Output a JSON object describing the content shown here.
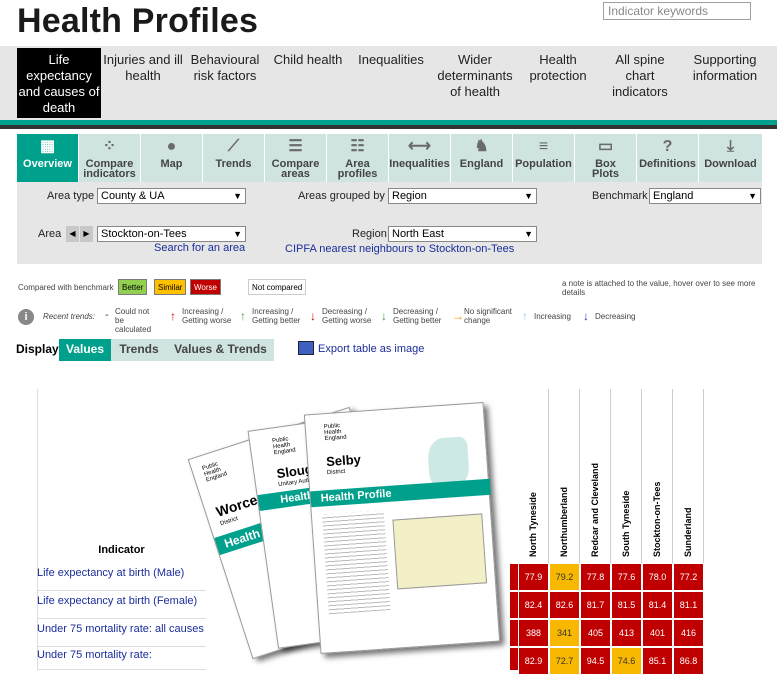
{
  "header": {
    "title": "Health Profiles",
    "search_placeholder": "Indicator keywords"
  },
  "nav": {
    "items": [
      {
        "label": "Life expectancy and causes of death"
      },
      {
        "label": "Injuries and ill health"
      },
      {
        "label": "Behavioural risk factors"
      },
      {
        "label": "Child health"
      },
      {
        "label": "Inequalities"
      },
      {
        "label": "Wider determinants of health"
      },
      {
        "label": "Health protection"
      },
      {
        "label": "All spine chart indicators"
      },
      {
        "label": "Supporting information"
      }
    ]
  },
  "tabs": [
    {
      "label": "Overview",
      "icon": "grid-icon"
    },
    {
      "label": "Compare indicators",
      "icon": "scatter-icon"
    },
    {
      "label": "Map",
      "icon": "pin-icon"
    },
    {
      "label": "Trends",
      "icon": "line-chart-icon"
    },
    {
      "label": "Compare areas",
      "icon": "bars-icon"
    },
    {
      "label": "Area profiles",
      "icon": "sliders-icon"
    },
    {
      "label": "Inequalities",
      "icon": "range-icon"
    },
    {
      "label": "England",
      "icon": "england-icon"
    },
    {
      "label": "Population",
      "icon": "population-icon"
    },
    {
      "label": "Box Plots",
      "icon": "boxplot-icon"
    },
    {
      "label": "Definitions",
      "icon": "question-icon"
    },
    {
      "label": "Download",
      "icon": "download-icon"
    }
  ],
  "filters": {
    "area_type_label": "Area type",
    "area_type_value": "County & UA",
    "grouped_label": "Areas grouped by",
    "grouped_value": "Region",
    "benchmark_label": "Benchmark",
    "benchmark_value": "England",
    "area_label": "Area",
    "area_value": "Stockton-on-Tees",
    "region_label": "Region",
    "region_value": "North East",
    "search_area_link": "Search for an area",
    "cipfa_link": "CIPFA nearest neighbours to Stockton-on-Tees"
  },
  "legend": {
    "compared_label": "Compared with benchmark",
    "better": "Better",
    "similar": "Similar",
    "worse": "Worse",
    "not_compared": "Not compared",
    "note": "a note is attached to the value, hover over to see more details",
    "recent_trends_label": "Recent trends:",
    "trends": [
      {
        "symbol": "-",
        "text": "Could not be calculated"
      },
      {
        "symbol": "↑",
        "text": "Increasing / Getting worse"
      },
      {
        "symbol": "↑",
        "text": "Increasing / Getting better"
      },
      {
        "symbol": "↓",
        "text": "Decreasing / Getting worse"
      },
      {
        "symbol": "↓",
        "text": "Decreasing / Getting better"
      },
      {
        "symbol": "→",
        "text": "No significant change"
      },
      {
        "symbol": "↑",
        "text": "Increasing"
      },
      {
        "symbol": "↓",
        "text": "Decreasing"
      }
    ],
    "colors": {
      "better": "#92d050",
      "similar": "#ffc000",
      "worse": "#c00000"
    }
  },
  "display": {
    "label": "Display",
    "options": [
      "Values",
      "Trends",
      "Values & Trends"
    ],
    "export_label": "Export table as image"
  },
  "table": {
    "indicator_header": "Indicator",
    "areas": [
      "North Tyneside",
      "Northumberland",
      "Redcar and Cleveland",
      "South Tyneside",
      "Stockton-on-Tees",
      "Sunderland"
    ],
    "rows": [
      {
        "indicator": "Life expectancy at birth (Male)",
        "values": [
          "77.9",
          "79.2",
          "77.8",
          "77.6",
          "78.0",
          "77.2"
        ],
        "status": [
          "worse",
          "similar",
          "worse",
          "worse",
          "worse",
          "worse"
        ]
      },
      {
        "indicator": "Life expectancy at birth (Female)",
        "values": [
          "82.4",
          "82.6",
          "81.7",
          "81.5",
          "81.4",
          "81.1"
        ],
        "status": [
          "worse",
          "worse",
          "worse",
          "worse",
          "worse",
          "worse"
        ]
      },
      {
        "indicator": "Under 75 mortality rate: all causes",
        "values": [
          "388",
          "341",
          "405",
          "413",
          "401",
          "416"
        ],
        "status": [
          "worse",
          "similar",
          "worse",
          "worse",
          "worse",
          "worse"
        ]
      },
      {
        "indicator": "Under 75 mortality rate:",
        "values": [
          "82.9",
          "72.7",
          "94.5",
          "74.6",
          "85.1",
          "86.8"
        ],
        "status": [
          "worse",
          "similar",
          "worse",
          "similar",
          "worse",
          "worse"
        ]
      }
    ]
  },
  "brochures": [
    {
      "org": "Public Health England",
      "area": "Worcester",
      "sub": "District",
      "heading": "Health P"
    },
    {
      "org": "Public Health England",
      "area": "Slough",
      "sub": "Unitary Authority",
      "heading": "Health P"
    },
    {
      "org": "Public Health England",
      "area": "Selby",
      "sub": "District",
      "heading": "Health Profile"
    }
  ]
}
